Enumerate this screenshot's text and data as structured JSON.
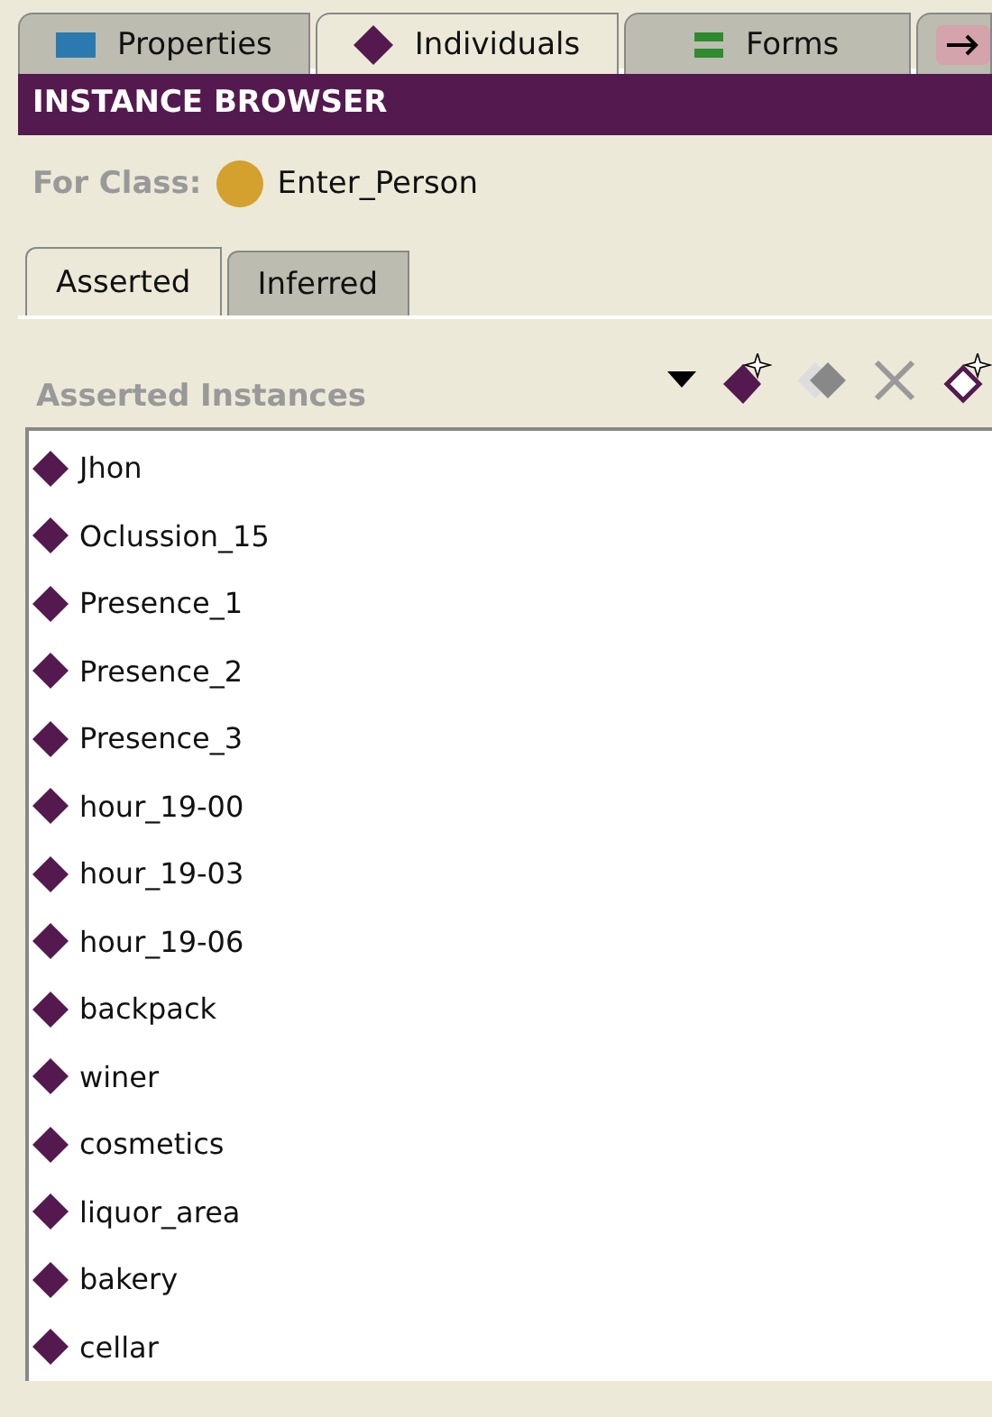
{
  "tabs": [
    {
      "label": "Properties",
      "kind": "properties",
      "selected": false
    },
    {
      "label": "Individuals",
      "kind": "individuals",
      "selected": true
    },
    {
      "label": "Forms",
      "kind": "forms",
      "selected": false
    },
    {
      "kind": "arrow",
      "selected": false
    }
  ],
  "panel": {
    "title": "INSTANCE BROWSER",
    "class_label": "For Class:",
    "class_name": "Enter_Person"
  },
  "subtabs": [
    {
      "label": "Asserted",
      "selected": true
    },
    {
      "label": "Inferred",
      "selected": false
    }
  ],
  "list_header": {
    "title": "Asserted Instances"
  },
  "toolbar": [
    {
      "kind": "dropdown",
      "disabled": false
    },
    {
      "kind": "create",
      "disabled": false
    },
    {
      "kind": "copy",
      "disabled": true
    },
    {
      "kind": "delete",
      "disabled": true
    },
    {
      "kind": "annotate",
      "disabled": false
    }
  ],
  "instances": [
    {
      "name": "Jhon"
    },
    {
      "name": "Oclussion_15"
    },
    {
      "name": "Presence_1"
    },
    {
      "name": "Presence_2"
    },
    {
      "name": "Presence_3"
    },
    {
      "name": "hour_19-00"
    },
    {
      "name": "hour_19-03"
    },
    {
      "name": "hour_19-06"
    },
    {
      "name": "backpack"
    },
    {
      "name": "winer"
    },
    {
      "name": "cosmetics"
    },
    {
      "name": "liquor_area"
    },
    {
      "name": "bakery"
    },
    {
      "name": "cellar"
    }
  ]
}
